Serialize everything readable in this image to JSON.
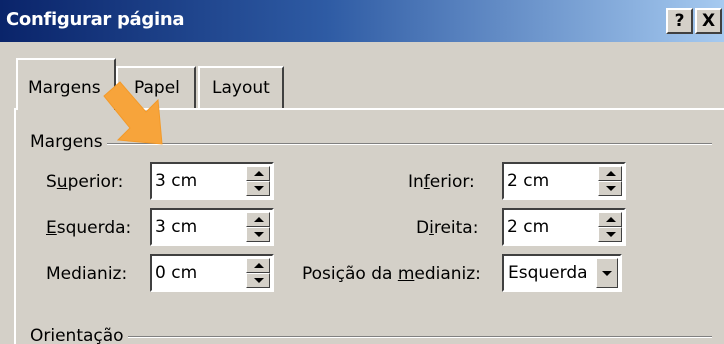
{
  "window": {
    "title": "Configurar página",
    "help_button": "?",
    "close_button": "X"
  },
  "tabs": [
    {
      "label": "Margens",
      "active": true
    },
    {
      "label": "Papel",
      "active": false
    },
    {
      "label": "Layout",
      "active": false
    }
  ],
  "groups": {
    "margens": "Margens",
    "orientacao": "Orientação"
  },
  "fields": {
    "superior": {
      "label_pre": "S",
      "label_acc": "u",
      "label_post": "perior:",
      "value": "3 cm"
    },
    "esquerda": {
      "label_pre": "",
      "label_acc": "E",
      "label_post": "squerda:",
      "value": "3 cm"
    },
    "medianiz": {
      "label_pre": "Medianiz",
      "label_acc": "",
      "label_post": ":",
      "value": "0 cm"
    },
    "inferior": {
      "label_pre": "In",
      "label_acc": "f",
      "label_post": "erior:",
      "value": "2 cm"
    },
    "direita": {
      "label_pre": "D",
      "label_acc": "i",
      "label_post": "reita:",
      "value": "2 cm"
    },
    "posicao": {
      "label_pre": "Posição da ",
      "label_acc": "m",
      "label_post": "edianiz:",
      "value": "Esquerda"
    }
  },
  "colors": {
    "annotation_arrow": "#f7a43b",
    "title_gradient_start": "#0a246a",
    "title_gradient_end": "#a6caf0",
    "dialog_face": "#d4d0c8"
  },
  "icons": {
    "annotation": "arrow-pointer-icon",
    "spin_up": "triangle-up-icon",
    "spin_down": "triangle-down-icon",
    "dropdown": "chevron-down-icon"
  }
}
